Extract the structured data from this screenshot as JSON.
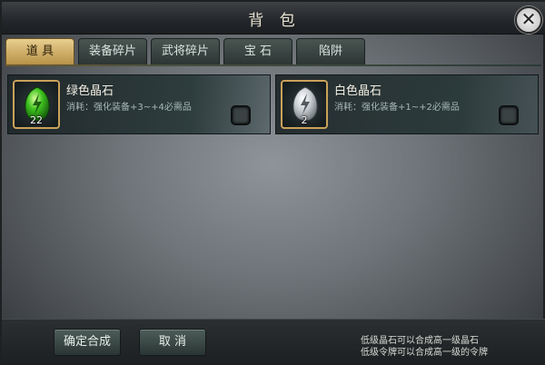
{
  "window": {
    "title": "背 包",
    "close_glyph": "✕"
  },
  "tabs": [
    {
      "label": "道 具",
      "active": true
    },
    {
      "label": "装备碎片",
      "active": false
    },
    {
      "label": "武将碎片",
      "active": false
    },
    {
      "label": "宝 石",
      "active": false
    },
    {
      "label": "陷阱",
      "active": false
    }
  ],
  "items": [
    {
      "name": "绿色晶石",
      "count": "22",
      "desc": "消耗：强化装备+3~+4必需品",
      "gem_color": "#3ec11f",
      "icon": "green-crystal-icon"
    },
    {
      "name": "白色晶石",
      "count": "2",
      "desc": "消耗：强化装备+1~+2必需品",
      "gem_color": "#c7ccd0",
      "icon": "white-crystal-icon"
    }
  ],
  "buttons": {
    "confirm": "确定合成",
    "cancel": "取 消"
  },
  "hints": [
    "低级晶石可以合成高一级晶石",
    "低级令牌可以合成高一级的令牌"
  ],
  "colors": {
    "active_tab": "#d6b46b",
    "slot_border": "#c9a25a"
  }
}
